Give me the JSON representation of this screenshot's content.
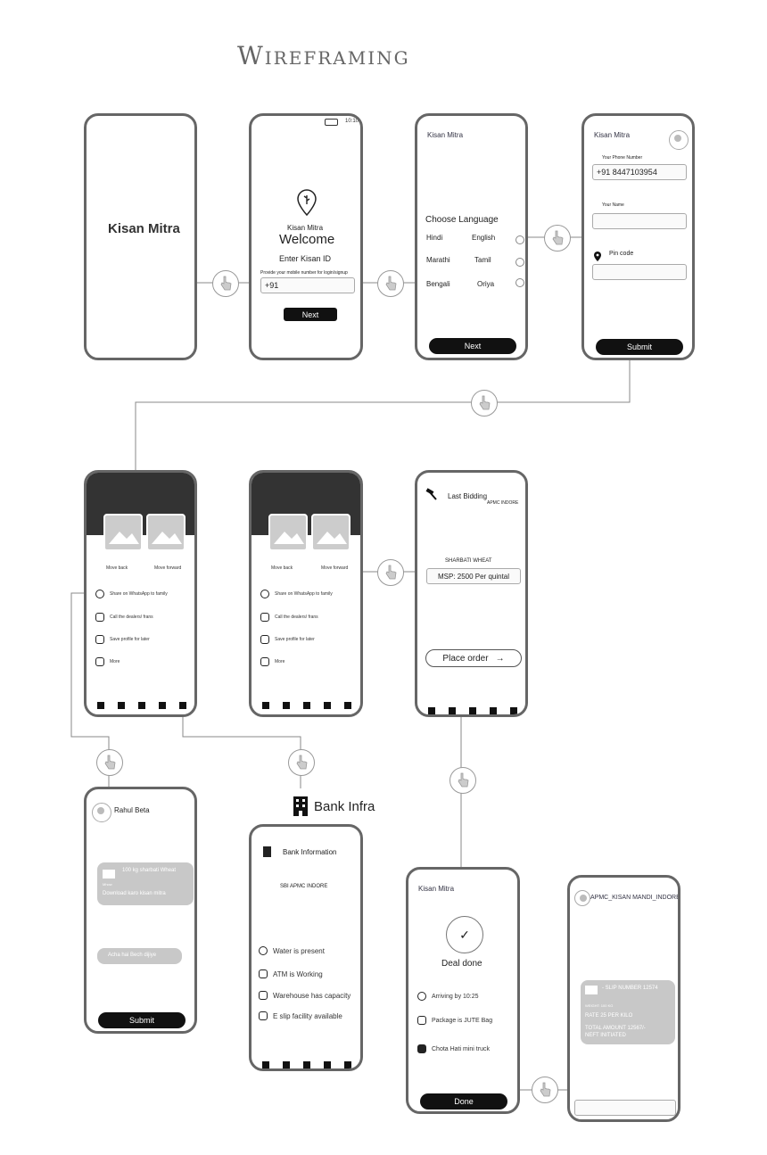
{
  "page_title": "Wireframing",
  "screen_splash": {
    "app_name": "Kisan Mitra"
  },
  "screen_login": {
    "time": "10:10",
    "app_name": "Kisan Mitra",
    "welcome": "Welcome",
    "enter_id": "Enter Kisan ID",
    "hint": "Provide your mobile number for login/signup",
    "country_code": "+91",
    "next": "Next"
  },
  "screen_language": {
    "app_name": "Kisan Mitra",
    "heading": "Choose Language",
    "langs": [
      "Hindi",
      "English",
      "Marathi",
      "Tamil",
      "Bengali",
      "Oriya"
    ],
    "next": "Next"
  },
  "screen_profile": {
    "app_name": "Kisan Mitra",
    "phone_label": "Your Phone Number",
    "phone_value": "+91 8447103954",
    "name_label": "Your Name",
    "pin_label": "Pin code",
    "submit": "Submit"
  },
  "screen_home": {
    "move_back": "Move back",
    "move_forward": "Move forward",
    "actions": [
      "Share on WhatsApp to family",
      "Call the dealers/ frans",
      "Save profile for later",
      "More"
    ]
  },
  "screen_bidding": {
    "heading": "Last Bidding",
    "mandi": "APMC INDORE",
    "crop": "SHARBATI WHEAT",
    "msp": "MSP: 2500 Per quintal",
    "place_order": "Place order"
  },
  "screen_chat": {
    "name": "Rahul Beta",
    "msg1_title": "100 kg sharbati Wheat",
    "msg1_sub": "Mhow",
    "msg1_body": "Download karo kisan mitra",
    "msg2": "Acha hai Bech dijiye",
    "submit": "Submit"
  },
  "bank_infra": {
    "label": "Bank Infra",
    "heading": "Bank Information",
    "branch": "SBI APMC INDORE",
    "facilities": [
      "Water is present",
      "ATM is Working",
      "Warehouse has capacity",
      "E slip facility available"
    ]
  },
  "screen_deal": {
    "app_name": "Kisan Mitra",
    "status": "Deal done",
    "arriving": "Arriving by 10:25",
    "package": "Package is JUTE Bag",
    "vehicle": "Chota Hati mini truck",
    "done": "Done"
  },
  "screen_slip": {
    "header": "APMC_KISAN MANDI_INDORE",
    "slip_no": "- SLIP NUMBER 12574",
    "weight": "WEIGHT: 100 KG",
    "rate": "RATE 25 PER KILO",
    "total": "TOTAL AMOUNT 12567/-",
    "neft": "NEFT INITIATED"
  },
  "colors": {
    "frame": "#666666",
    "dark": "#111111",
    "bubble": "#c8c8c8"
  }
}
